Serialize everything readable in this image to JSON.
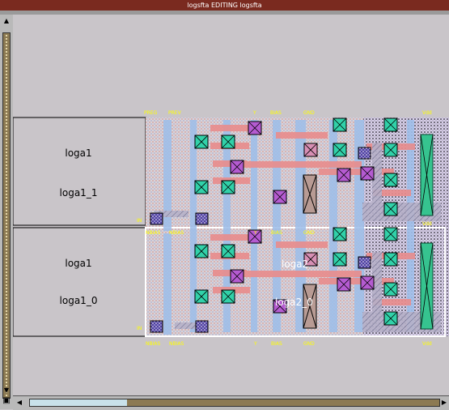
{
  "window": {
    "title": "logsfta EDITING logsfta"
  },
  "layout_instances": [
    {
      "cell_label": "loga1",
      "instance_label": "loga1_1"
    },
    {
      "cell_label": "loga1",
      "instance_label": "loga1_0"
    }
  ],
  "overlay_labels": {
    "loga2": "loga2",
    "loga2_0": "loga2_0"
  },
  "pin_labels": {
    "top": [
      "PREG",
      "PREV",
      "Y",
      "BIAS",
      "GND",
      "Vdd"
    ],
    "middle": [
      "NBIAS",
      "NBIAS",
      "Y",
      "BIAS",
      "GND",
      "Vdd"
    ],
    "bottom": [
      "NBIAS",
      "NBIAS",
      "Y",
      "BIAS",
      "GND",
      "Vdd"
    ],
    "left_upper": "IN",
    "left_lower": "IN"
  },
  "icons": {
    "scroll_up": "up-arrow-icon",
    "scroll_down": "down-arrow-icon",
    "scroll_left": "left-arrow-icon",
    "scroll_right": "right-arrow-icon"
  },
  "colors": {
    "title_bar": "#7a2a1f",
    "canvas_bg": "#c9c5c9",
    "pin_text": "#ffff00",
    "poly": "#e88b8b",
    "metal1": "#8fb6ea",
    "contact": "#31d1a9",
    "via": "#b55bd1"
  }
}
